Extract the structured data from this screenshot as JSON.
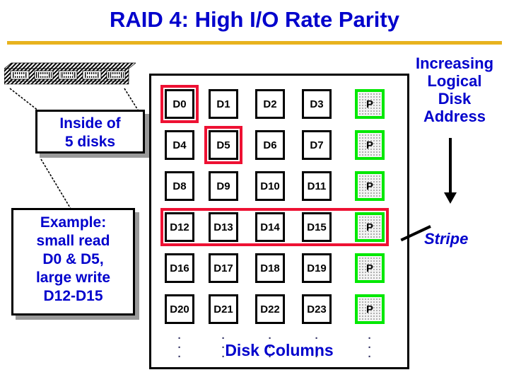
{
  "title": "RAID 4: High I/O Rate Parity",
  "colors": {
    "title_blue": "#0000CC",
    "rule_gold": "#E8B31E",
    "highlight_red": "#EE1133",
    "parity_green": "#00E800",
    "cell_black": "#000000"
  },
  "callouts": {
    "inside": {
      "line1": "Inside of",
      "line2": "5 disks"
    },
    "example": {
      "line1": "Example:",
      "line2": "small read",
      "line3": "D0 & D5,",
      "line4": "large write",
      "line5": "D12-D15"
    }
  },
  "grid": {
    "columns_label": "Disk Columns",
    "ellipsis": "·",
    "rows": [
      {
        "cells": [
          "D0",
          "D1",
          "D2",
          "D3",
          "P"
        ]
      },
      {
        "cells": [
          "D4",
          "D5",
          "D6",
          "D7",
          "P"
        ]
      },
      {
        "cells": [
          "D8",
          "D9",
          "D10",
          "D11",
          "P"
        ]
      },
      {
        "cells": [
          "D12",
          "D13",
          "D14",
          "D15",
          "P"
        ]
      },
      {
        "cells": [
          "D16",
          "D17",
          "D18",
          "D19",
          "P"
        ]
      },
      {
        "cells": [
          "D20",
          "D21",
          "D22",
          "D23",
          "P"
        ]
      }
    ],
    "parity_column_index": 4,
    "highlights": [
      {
        "name": "small-read-d0",
        "cells": [
          "D0"
        ]
      },
      {
        "name": "small-read-d5",
        "cells": [
          "D5"
        ]
      },
      {
        "name": "large-write-stripe",
        "cells": [
          "D12",
          "D13",
          "D14",
          "D15",
          "P"
        ]
      }
    ]
  },
  "annotations": {
    "increasing_address": {
      "line1": "Increasing",
      "line2": "Logical",
      "line3": "Disk",
      "line4": "Address"
    },
    "stripe": "Stripe"
  }
}
